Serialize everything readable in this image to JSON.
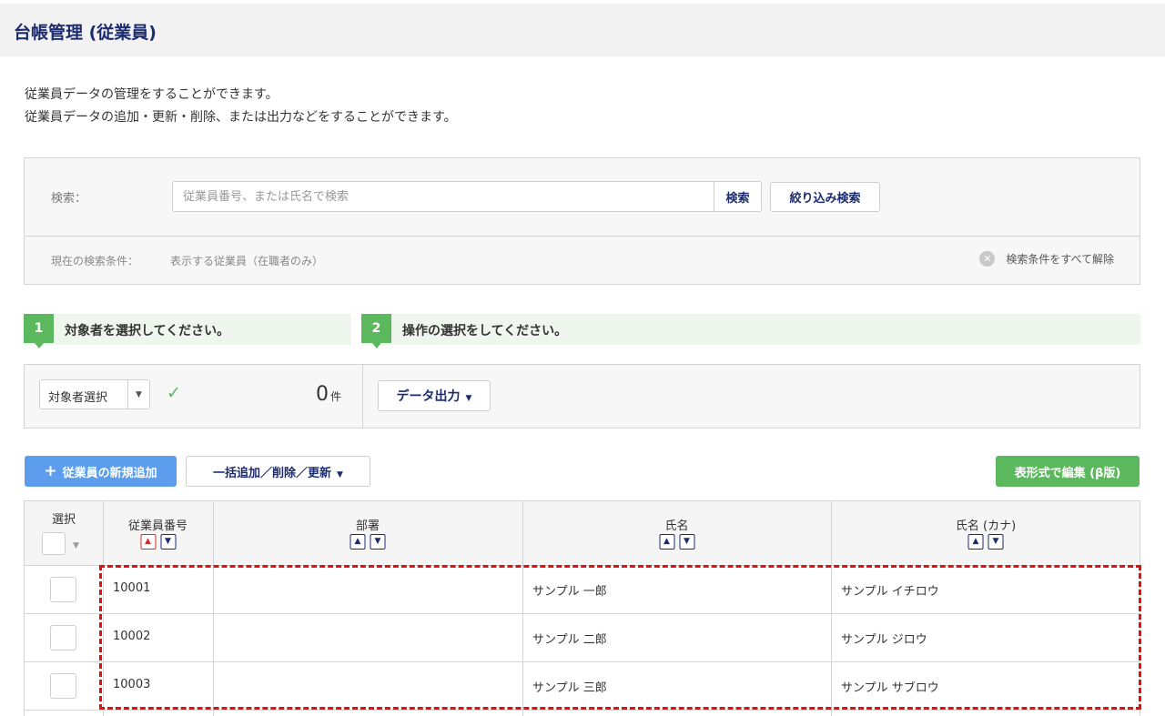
{
  "header": {
    "title": "台帳管理 (従業員)"
  },
  "description": {
    "line1": "従業員データの管理をすることができます。",
    "line2": "従業員データの追加・更新・削除、または出力などをすることができます。"
  },
  "search": {
    "label": "検索：",
    "placeholder": "従業員番号、または氏名で検索",
    "value": "",
    "search_button": "検索",
    "filter_button": "絞り込み検索",
    "current_condition_label": "現在の検索条件：",
    "current_condition_value": "表示する従業員（在職者のみ）",
    "clear_all_label": "検索条件をすべて解除",
    "clear_icon": "close-circle-icon"
  },
  "steps": [
    {
      "number": "1",
      "text": "対象者を選択してください。"
    },
    {
      "number": "2",
      "text": "操作の選択をしてください。"
    }
  ],
  "operations": {
    "target_select_label": "対象者選択",
    "selected_count": "0",
    "count_unit": "件",
    "export_button": "データ出力"
  },
  "actions": {
    "add_button": "従業員の新規追加",
    "bulk_button": "一括追加／削除／更新",
    "table_edit_button": "表形式で編集 (β版)"
  },
  "table": {
    "select_header": "選択",
    "columns": [
      "従業員番号",
      "部署",
      "氏名",
      "氏名 (カナ)"
    ],
    "rows": [
      {
        "id": "10001",
        "department": "",
        "name": "サンプル 一郎",
        "kana": "サンプル イチロウ"
      },
      {
        "id": "10002",
        "department": "",
        "name": "サンプル 二郎",
        "kana": "サンプル ジロウ"
      },
      {
        "id": "10003",
        "department": "",
        "name": "サンプル 三郎",
        "kana": "サンプル サブロウ"
      }
    ]
  },
  "colors": {
    "primary_text": "#1d2c6e",
    "accent_green": "#5cb85c",
    "accent_blue": "#5c9ded",
    "highlight_red": "#e01010"
  }
}
